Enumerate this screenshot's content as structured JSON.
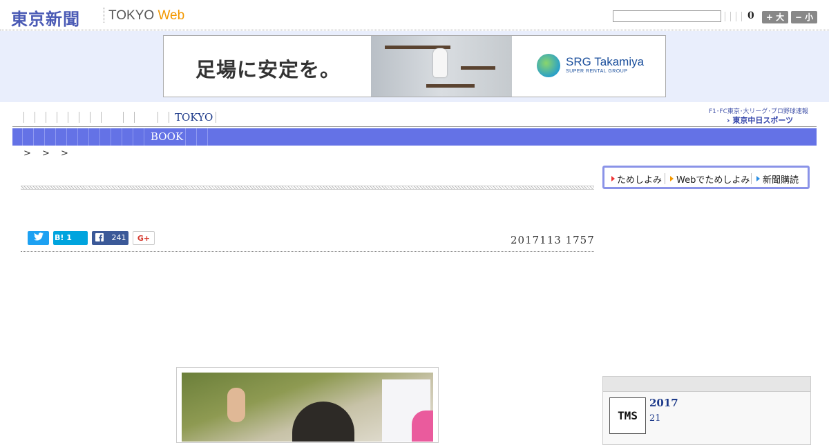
{
  "header": {
    "logo_cn": "東京新聞",
    "logo_en_main": "TOKYO",
    "logo_en_web": "Web",
    "search_value": "",
    "counter": "0",
    "font_larger_label": "+ 大",
    "font_smaller_label": "− 小"
  },
  "ad": {
    "headline": "足場に安定を。",
    "brand": "SRG Takamiya",
    "brand_sub": "SUPER RENTAL GROUP"
  },
  "nav1": {
    "tokyo_label": "TOKYO",
    "sports_top": "F1･FC東京･大リーグ･プロ野球速報",
    "sports_logo": "東京中日スポーツ"
  },
  "nav2": {
    "book_label": "BOOK"
  },
  "breadcrumb": "> > >",
  "article": {
    "timestamp": "2017113 1757",
    "share": {
      "hatena_label": "B! 1",
      "facebook_count": "241",
      "gplus_label": "G+"
    }
  },
  "subscribe": {
    "items": [
      "ためしよみ",
      "Webでためしよみ",
      "新聞購読"
    ]
  },
  "sidebar_box": {
    "thumb_text": "TMS",
    "title": "2017",
    "subtitle": "21"
  },
  "colors": {
    "nav_bar": "#6472e6",
    "logo_blue": "#4a5ab5",
    "web_orange": "#f39800",
    "ad_band": "#e9eefc"
  },
  "icons": {
    "twitter": "twitter-icon",
    "facebook": "facebook-icon"
  }
}
